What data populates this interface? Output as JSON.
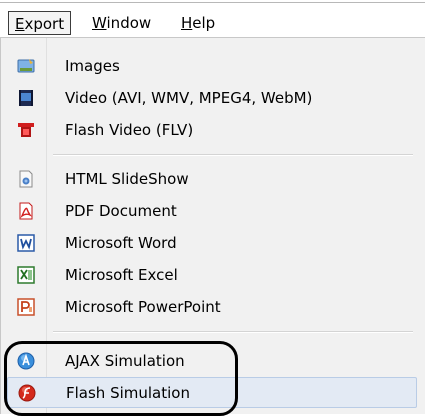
{
  "menubar": {
    "export": {
      "accel": "E",
      "rest": "xport"
    },
    "window": {
      "accel": "W",
      "rest": "indow"
    },
    "help": {
      "accel": "H",
      "rest": "elp"
    }
  },
  "menu": {
    "items": [
      {
        "label": "Images",
        "icon": "images-icon"
      },
      {
        "label": "Video (AVI, WMV, MPEG4, WebM)",
        "icon": "video-icon"
      },
      {
        "label": "Flash Video (FLV)",
        "icon": "flash-video-icon"
      },
      {
        "label": "HTML SlideShow",
        "icon": "html-slideshow-icon"
      },
      {
        "label": "PDF Document",
        "icon": "pdf-icon"
      },
      {
        "label": "Microsoft Word",
        "icon": "word-icon"
      },
      {
        "label": "Microsoft Excel",
        "icon": "excel-icon"
      },
      {
        "label": "Microsoft PowerPoint",
        "icon": "powerpoint-icon"
      },
      {
        "label": "AJAX Simulation",
        "icon": "ajax-icon"
      },
      {
        "label": "Flash Simulation",
        "icon": "flash-icon",
        "highlighted": true
      }
    ]
  },
  "colors": {
    "highlight": "#e3eaf4",
    "callout": "#000000"
  }
}
